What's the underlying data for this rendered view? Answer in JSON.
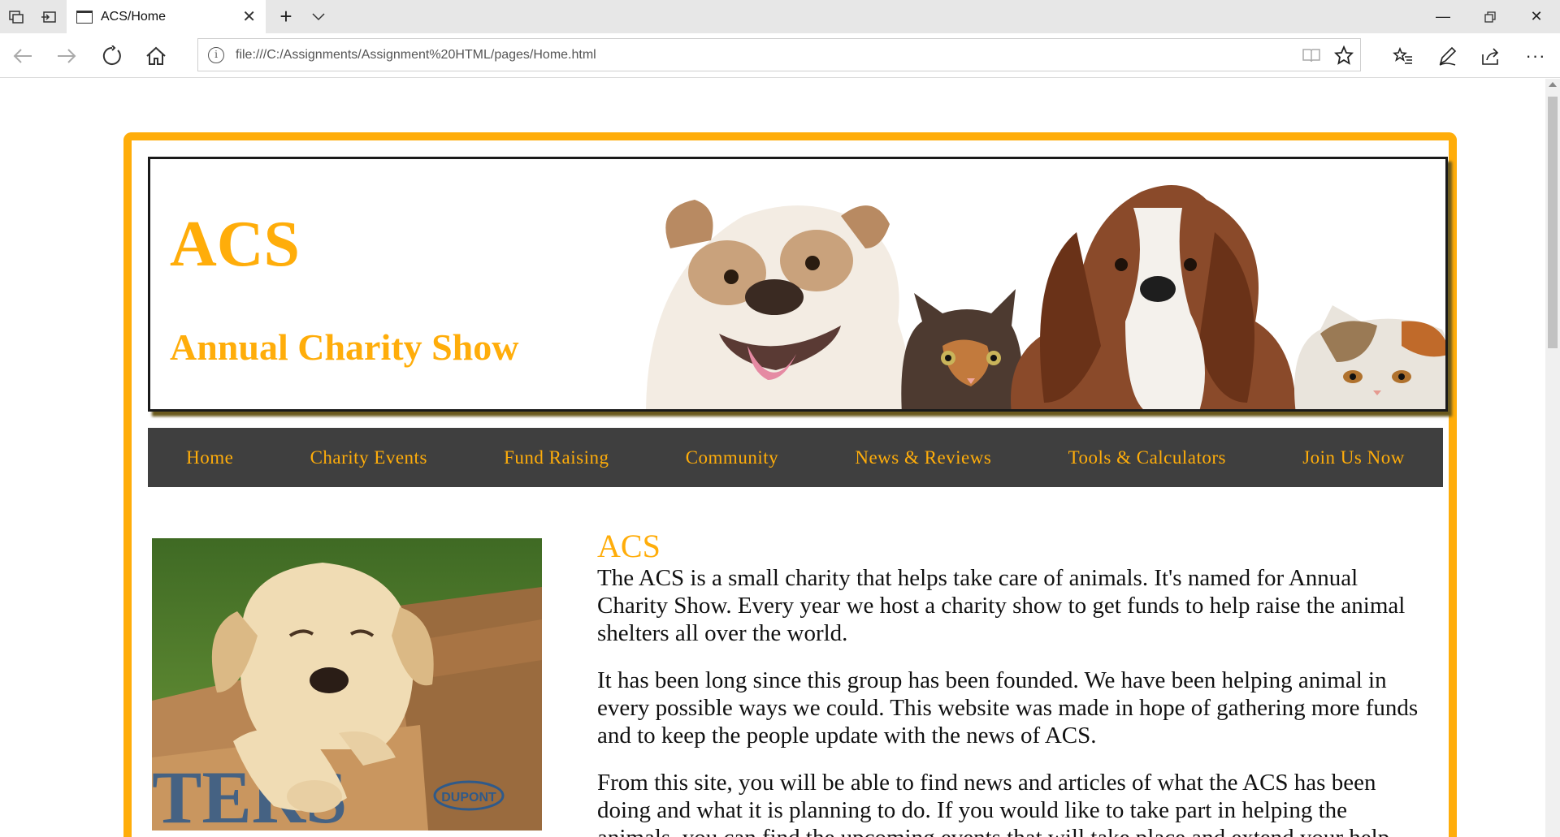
{
  "browser": {
    "tab_title": "ACS/Home",
    "url": "file:///C:/Assignments/Assignment%20HTML/pages/Home.html"
  },
  "site": {
    "logo": "ACS",
    "tagline": "Annual Charity Show",
    "brand_color": "#ffad0a",
    "menu_bg": "#3f3f3f"
  },
  "menu": [
    {
      "label": "Home"
    },
    {
      "label": "Charity Events"
    },
    {
      "label": "Fund Raising"
    },
    {
      "label": "Community"
    },
    {
      "label": "News & Reviews"
    },
    {
      "label": "Tools & Calculators"
    },
    {
      "label": "Join Us Now"
    }
  ],
  "content": {
    "heading": "ACS",
    "paragraphs": [
      "The ACS is a small charity that helps take care of animals. It's named for Annual Charity Show. Every year we host a charity show to get funds to help raise the animal shelters all over the world.",
      "It has been long since this group has been founded. We have been helping animal in every possible ways we could. This website was made in hope of gathering more funds and to keep the people update with the news of ACS.",
      "From this site, you will be able to find news and articles of what the ACS has been doing and what it is planning to do. If you would like to take part in helping the animals, you can find the upcoming events that will take place and extend your help."
    ]
  },
  "images": {
    "header_animals": "bulldog, kitten, basset hound, persian cat",
    "puppy": "labrador puppy in wooden crate",
    "crate_text": "DUPONT"
  }
}
